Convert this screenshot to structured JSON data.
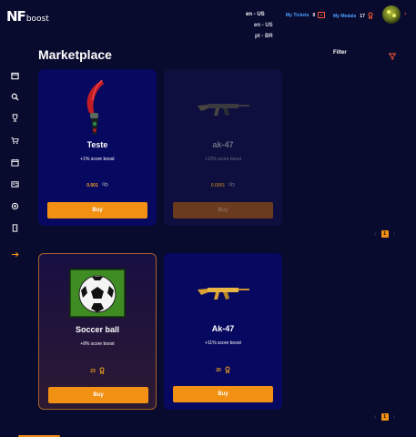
{
  "header": {
    "logo_main": "NF",
    "logo_sub": "boost",
    "language": "en - US",
    "language_options": [
      "en - US",
      "pt - BR"
    ],
    "tickets_label": "My Tickets",
    "tickets_value": "0",
    "medals_label": "My Medals",
    "medals_value": "17",
    "menu_caret": "›"
  },
  "sidebar": {
    "items": [
      "window-icon",
      "search-icon",
      "trophy-icon",
      "cart-icon",
      "calendar-icon",
      "id-card-icon",
      "target-icon",
      "door-icon",
      "logout-arrow-icon"
    ]
  },
  "main": {
    "title": "Marketplace",
    "filter_label": "Filter",
    "accent": "#f29014",
    "cards": [
      {
        "name": "Teste",
        "boost": "+1% score boost",
        "price": "0.001",
        "currency_icon": "link-icon",
        "buy_label": "Buy",
        "image": "knife-icon"
      },
      {
        "name": "ak-47",
        "boost": "+12% score boost",
        "price": "0.0001",
        "currency_icon": "link-icon",
        "buy_label": "Buy",
        "image": "rifle-icon"
      },
      {
        "name": "Soccer ball",
        "boost": "+8% score boost",
        "price": "23",
        "currency_icon": "medal-icon",
        "buy_label": "Buy",
        "image": "soccer-ball-icon"
      },
      {
        "name": "Ak-47",
        "boost": "+11% score boost",
        "price": "20",
        "currency_icon": "medal-icon",
        "buy_label": "Buy",
        "image": "golden-rifle-icon"
      }
    ],
    "pager_top": {
      "prev": "‹",
      "page": "1",
      "next": "›"
    },
    "pager_bottom": {
      "prev": "‹",
      "page": "1",
      "next": "›"
    }
  }
}
